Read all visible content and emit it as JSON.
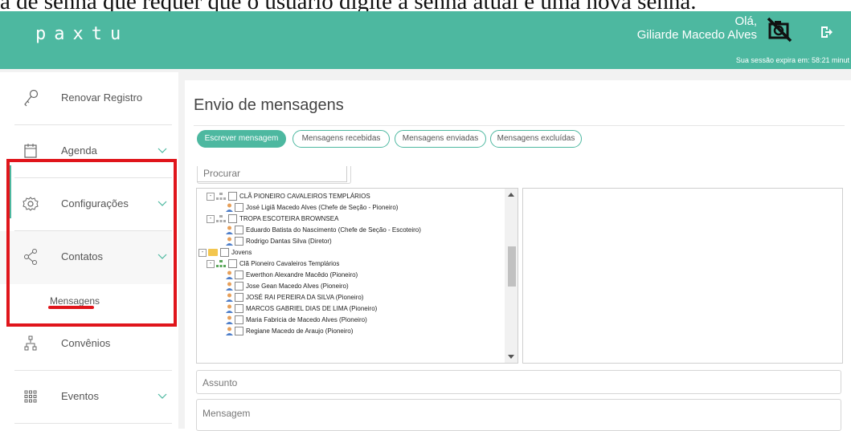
{
  "caption": "a de senha que requer que o usuário digite a senha atual e uma nova senha.",
  "header": {
    "logo": "paxtu",
    "greeting": "Olá,",
    "user_name": "Giliarde Macedo Alves",
    "session_text": "Sua sessão expira em: 58:21 minut",
    "icons": [
      "no-camera-icon",
      "logout-icon"
    ]
  },
  "sidebar": {
    "items": [
      {
        "label": "Renovar Registro",
        "icon": "key-icon",
        "chevron": false
      },
      {
        "label": "Agenda",
        "icon": "calendar-icon",
        "chevron": true
      },
      {
        "label": "Configurações",
        "icon": "gear-icon",
        "chevron": true
      },
      {
        "label": "Contatos",
        "icon": "share-icon",
        "chevron": true,
        "active": true
      },
      {
        "label": "Convênios",
        "icon": "org-chart-icon",
        "chevron": false
      },
      {
        "label": "Eventos",
        "icon": "grid-icon",
        "chevron": true
      }
    ],
    "sub_item": "Mensagens"
  },
  "main": {
    "title": "Envio de mensagens",
    "tabs": [
      "Escrever mensagem",
      "Mensagens recebidas",
      "Mensagens enviadas",
      "Mensagens excluídas"
    ],
    "search_placeholder": "Procurar",
    "tree": [
      {
        "text": "CLÃ PIONEIRO CAVALEIROS TEMPLÁRIOS",
        "type": "group"
      },
      {
        "text": "José Ligiã Macedo Alves (Chefe de Seção - Pioneiro)",
        "type": "person"
      },
      {
        "text": "TROPA ESCOTEIRA BROWNSEA",
        "type": "group"
      },
      {
        "text": "Eduardo Batista do Nascimento (Chefe de Seção - Escoteiro)",
        "type": "person"
      },
      {
        "text": "Rodrigo Dantas Silva (Diretor)",
        "type": "person"
      },
      {
        "text": "Jovens",
        "type": "folder"
      },
      {
        "text": "Clã Pioneiro Cavaleiros Templários",
        "type": "group"
      },
      {
        "text": "Ewerthon Alexandre Macêdo (Pioneiro)",
        "type": "person"
      },
      {
        "text": "Jose Gean Macedo Alves (Pioneiro)",
        "type": "person"
      },
      {
        "text": "JOSÉ RAI PEREIRA DA SILVA (Pioneiro)",
        "type": "person"
      },
      {
        "text": "MARCOS GABRIEL DIAS DE LIMA (Pioneiro)",
        "type": "person"
      },
      {
        "text": "Maria Fabricia de Macedo Alves (Pioneiro)",
        "type": "person"
      },
      {
        "text": "Regiane Macedo de Araujo (Pioneiro)",
        "type": "person"
      }
    ],
    "subject_placeholder": "Assunto",
    "message_placeholder": "Mensagem"
  },
  "colors": {
    "accent": "#4db8a0",
    "highlight": "#e0151b"
  }
}
